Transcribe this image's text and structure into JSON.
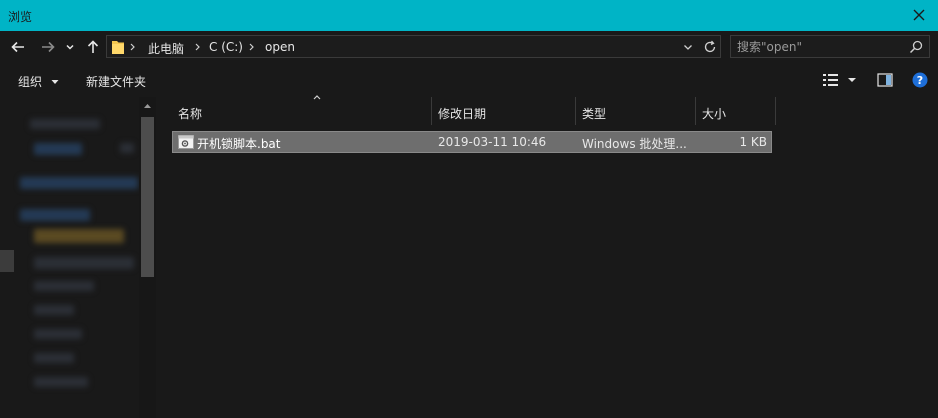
{
  "window": {
    "title": "浏览"
  },
  "address": {
    "crumbs": [
      "此电脑",
      "C (C:)",
      "open"
    ]
  },
  "search": {
    "placeholder": "搜索\"open\""
  },
  "toolbar": {
    "organize_label": "组织",
    "new_folder_label": "新建文件夹"
  },
  "columns": {
    "name": "名称",
    "date": "修改日期",
    "type": "类型",
    "size": "大小"
  },
  "files": [
    {
      "name": "开机锁脚本.bat",
      "date": "2019-03-11 10:46",
      "type": "Windows 批处理...",
      "size": "1 KB"
    }
  ],
  "colors": {
    "titlebar": "#00b4c6",
    "background": "#191919",
    "selection": "#6e6e6e",
    "annotation_arrow": "#e02020",
    "help_icon": "#1e6fd9"
  },
  "icons": [
    "close-icon",
    "back-arrow-icon",
    "forward-arrow-icon",
    "recent-dropdown-icon",
    "up-arrow-icon",
    "folder-icon",
    "chevron-right-icon",
    "chevron-down-icon",
    "refresh-icon",
    "search-icon",
    "view-options-icon",
    "preview-pane-icon",
    "help-icon",
    "batch-file-icon",
    "annotation-arrow-icon"
  ]
}
